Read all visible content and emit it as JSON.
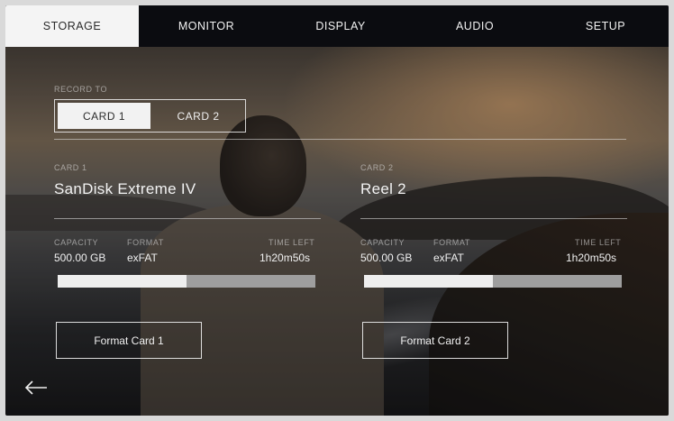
{
  "tabs": [
    {
      "label": "STORAGE",
      "active": true
    },
    {
      "label": "MONITOR",
      "active": false
    },
    {
      "label": "DISPLAY",
      "active": false
    },
    {
      "label": "AUDIO",
      "active": false
    },
    {
      "label": "SETUP",
      "active": false
    }
  ],
  "record_to": {
    "label": "RECORD TO",
    "options": [
      "CARD 1",
      "CARD 2"
    ],
    "selected": "CARD 1"
  },
  "cards": [
    {
      "label": "CARD 1",
      "name": "SanDisk Extreme IV",
      "capacity_label": "CAPACITY",
      "capacity": "500.00 GB",
      "format_label": "FORMAT",
      "format": "exFAT",
      "time_left_label": "TIME LEFT",
      "time_left": "1h20m50s",
      "used_fraction": 0.5,
      "format_button": "Format Card 1"
    },
    {
      "label": "CARD 2",
      "name": "Reel 2",
      "capacity_label": "CAPACITY",
      "capacity": "500.00 GB",
      "format_label": "FORMAT",
      "format": "exFAT",
      "time_left_label": "TIME LEFT",
      "time_left": "1h20m50s",
      "used_fraction": 0.5,
      "format_button": "Format Card 2"
    }
  ],
  "back_icon": "arrow-left-icon",
  "colors": {
    "tabbar_bg": "#0b0c10",
    "active_tab_bg": "#f4f4f4",
    "bar_fill": "#eeeeee",
    "bar_track": "#9e9e9e"
  }
}
